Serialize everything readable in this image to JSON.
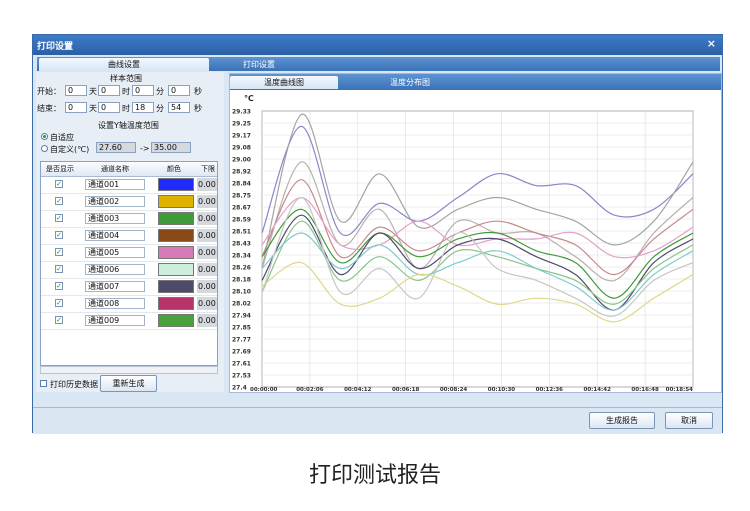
{
  "window": {
    "title": "打印设置",
    "close_label": "×"
  },
  "tabs": [
    {
      "label": "曲线设置"
    },
    {
      "label": "打印设置"
    }
  ],
  "sample_range": {
    "title": "样本范围",
    "start_label": "开始：",
    "end_label": "结束：",
    "day_unit": "天",
    "hour_unit": "时",
    "min_unit": "分",
    "sec_unit": "秒",
    "start": {
      "a": "0",
      "day": "0",
      "hour": "0",
      "min": "0"
    },
    "end": {
      "a": "0",
      "day": "0",
      "hour": "18",
      "min": "54"
    }
  },
  "yrange": {
    "title": "设置Y轴温度范围",
    "auto_label": "自适应",
    "custom_label": "自定义(℃)",
    "min": "27.60",
    "arrow": "->",
    "max": "35.00"
  },
  "table": {
    "headers": [
      "是否显示",
      "通道名称",
      "颜色",
      "下限"
    ],
    "rows": [
      {
        "name": "通道001",
        "color": "#1f2bff",
        "low": "0.00"
      },
      {
        "name": "通道002",
        "color": "#e0b200",
        "low": "0.00"
      },
      {
        "name": "通道003",
        "color": "#3f9a3a",
        "low": "0.00"
      },
      {
        "name": "通道004",
        "color": "#8a4a17",
        "low": "0.00"
      },
      {
        "name": "通道005",
        "color": "#d77bb8",
        "low": "0.00"
      },
      {
        "name": "通道006",
        "color": "#cdeedd",
        "low": "0.00"
      },
      {
        "name": "通道007",
        "color": "#4e4a6c",
        "low": "0.00"
      },
      {
        "name": "通道008",
        "color": "#b8336a",
        "low": "0.00"
      },
      {
        "name": "通道009",
        "color": "#4aa03a",
        "low": "0.00"
      }
    ]
  },
  "print_history_label": "打印历史数据",
  "regenerate_label": "重新生成",
  "chart_tabs": [
    {
      "label": "温度曲线图"
    },
    {
      "label": "温度分布图"
    }
  ],
  "buttons": {
    "generate": "生成报告",
    "cancel": "取消"
  },
  "caption": "打印测试报告",
  "chart_data": {
    "type": "line",
    "unit_label": "℃",
    "ylim": [
      27.0,
      29.33
    ],
    "yticks": [
      "29.33",
      "29.25",
      "29.17",
      "29.08",
      "29.00",
      "28.92",
      "28.84",
      "28.75",
      "28.67",
      "28.59",
      "28.51",
      "28.43",
      "28.34",
      "28.26",
      "28.18",
      "28.10",
      "28.02",
      "27.94",
      "27.85",
      "27.77",
      "27.69",
      "27.61",
      "27.53",
      "27.4"
    ],
    "xticks": [
      "00:00:00",
      "00:02:06",
      "00:04:12",
      "00:06:18",
      "00:08:24",
      "00:10:30",
      "00:12:36",
      "00:14:42",
      "00:16:48",
      "00:18:54"
    ],
    "grid": true,
    "series": [
      {
        "color": "#8b86c8",
        "values": [
          28.3,
          29.2,
          28.3,
          28.55,
          28.4,
          28.6,
          28.8,
          28.7,
          28.7,
          28.45,
          28.5,
          28.8
        ]
      },
      {
        "color": "#a3a3a3",
        "values": [
          28.0,
          29.3,
          28.4,
          28.8,
          28.35,
          28.5,
          28.6,
          28.5,
          28.4,
          28.2,
          28.4,
          28.9
        ]
      },
      {
        "color": "#b8b0b0",
        "values": [
          28.0,
          28.9,
          28.2,
          28.5,
          28.0,
          28.4,
          28.3,
          28.3,
          28.1,
          27.9,
          28.3,
          28.6
        ]
      },
      {
        "color": "#c58a8a",
        "values": [
          28.1,
          28.75,
          28.1,
          28.35,
          28.15,
          28.3,
          28.4,
          28.3,
          28.2,
          27.95,
          28.25,
          28.5
        ]
      },
      {
        "color": "#e4a0c8",
        "values": [
          28.2,
          28.6,
          28.2,
          28.2,
          28.4,
          28.2,
          28.25,
          28.25,
          28.3,
          28.1,
          28.15,
          28.35
        ]
      },
      {
        "color": "#3f9a3a",
        "values": [
          28.1,
          28.5,
          28.05,
          28.3,
          28.1,
          28.25,
          28.3,
          28.15,
          28.05,
          27.75,
          28.1,
          28.3
        ]
      },
      {
        "color": "#4e4a6c",
        "values": [
          27.9,
          28.45,
          27.95,
          28.3,
          28.0,
          28.2,
          28.25,
          28.1,
          27.95,
          27.65,
          28.05,
          28.25
        ]
      },
      {
        "color": "#8ac48a",
        "values": [
          27.8,
          28.4,
          27.9,
          28.1,
          27.9,
          28.15,
          28.1,
          28.0,
          27.9,
          27.7,
          28.0,
          28.2
        ]
      },
      {
        "color": "#7ecbcb",
        "values": [
          28.0,
          28.3,
          28.0,
          28.2,
          27.95,
          28.05,
          28.15,
          28.0,
          27.85,
          27.65,
          27.95,
          28.15
        ]
      },
      {
        "color": "#c6c6c6",
        "values": [
          27.8,
          28.6,
          27.8,
          28.0,
          27.75,
          28.3,
          28.0,
          27.9,
          27.75,
          27.6,
          27.9,
          28.05
        ]
      },
      {
        "color": "#ddd98a",
        "values": [
          27.85,
          28.05,
          27.7,
          27.75,
          27.95,
          27.85,
          27.7,
          27.75,
          27.7,
          27.55,
          27.75,
          27.95
        ]
      }
    ]
  }
}
